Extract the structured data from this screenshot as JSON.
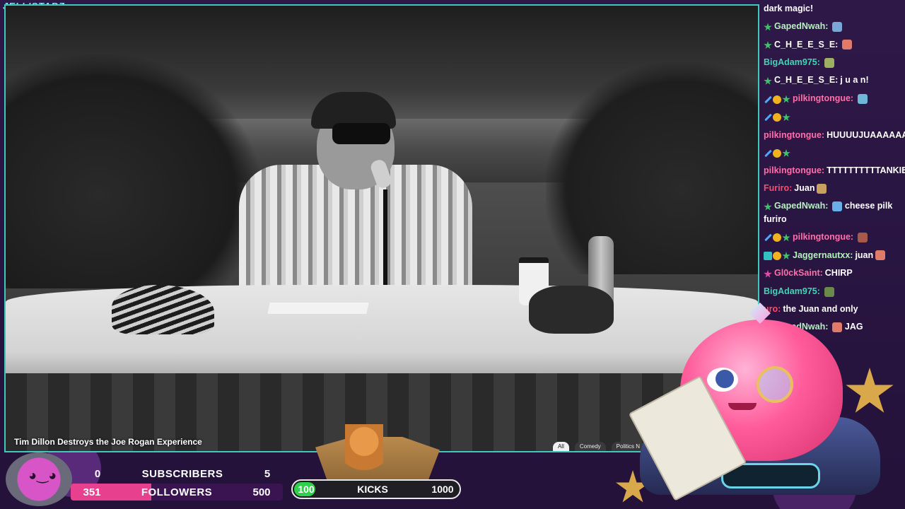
{
  "brand": "JELLISTARZ",
  "video": {
    "title": "Tim Dillon Destroys the Joe Rogan Experience",
    "chips": [
      "All",
      "Comedy",
      "Politics N"
    ]
  },
  "chat": [
    {
      "name": "",
      "name_color": "#ffffff",
      "badges": [],
      "text": "dark magic!"
    },
    {
      "name": "GapedNwah:",
      "name_color": "#b7f0c0",
      "badges": [
        "star"
      ],
      "text": "",
      "emote": "#7aa7d8"
    },
    {
      "name": "C_H_E_E_S_E:",
      "name_color": "#ffffff",
      "badges": [
        "star"
      ],
      "text": "",
      "emote": "#e07a6a"
    },
    {
      "name": "BigAdam975:",
      "name_color": "#3ed6b4",
      "badges": [],
      "text": "",
      "emote": "#9bb060"
    },
    {
      "name": "C_H_E_E_S_E:",
      "name_color": "#ffffff",
      "badges": [
        "star"
      ],
      "text": "j u a n!"
    },
    {
      "name": "pilkingtongue:",
      "name_color": "#ff6fa8",
      "badges": [
        "sword",
        "coin",
        "star"
      ],
      "text": "",
      "emote": "#6fb6d8"
    },
    {
      "name": "",
      "name_color": "#ffffff",
      "badges": [
        "sword",
        "coin",
        "star"
      ],
      "text": ""
    },
    {
      "name": "pilkingtongue:",
      "name_color": "#ff6fa8",
      "badges": [],
      "text": "HUUUUJUAAAAAAAAN"
    },
    {
      "name": "",
      "name_color": "#ffffff",
      "badges": [
        "sword",
        "coin",
        "star"
      ],
      "text": ""
    },
    {
      "name": "pilkingtongue:",
      "name_color": "#ff6fa8",
      "badges": [],
      "text": "TTTTTTTTTTANKIES"
    },
    {
      "name": "Furiro:",
      "name_color": "#ff4a6a",
      "badges": [],
      "text": "Juan",
      "emote": "#c8a060"
    },
    {
      "name": "GapedNwah:",
      "name_color": "#b7f0c0",
      "badges": [
        "star"
      ],
      "text": "cheese pilk furiro",
      "emote_before": "#6ab0e8"
    },
    {
      "name": "pilkingtongue:",
      "name_color": "#ff6fa8",
      "badges": [
        "sword",
        "coin",
        "star"
      ],
      "text": "",
      "emote": "#a85a4a"
    },
    {
      "name": "Jaggernautxx:",
      "name_color": "#b7f0c0",
      "badges": [
        "square",
        "coin",
        "star"
      ],
      "text": "juan",
      "emote": "#e07a6a"
    },
    {
      "name": "Gl0ckSaint:",
      "name_color": "#ff6fa8",
      "badges": [
        "pink"
      ],
      "text": "CHIRP"
    },
    {
      "name": "BigAdam975:",
      "name_color": "#3ed6b4",
      "badges": [],
      "text": "",
      "emote": "#6a8a4a"
    },
    {
      "name": "uro:",
      "name_color": "#ff4a6a",
      "badges": [],
      "text": "the Juan and only"
    },
    {
      "name": "GapedNwah:",
      "name_color": "#b7f0c0",
      "badges": [
        "star"
      ],
      "text": "JAG",
      "emote_before": "#e07a6a"
    }
  ],
  "stats": {
    "subscribers": {
      "label": "SUBSCRIBERS",
      "current": "0",
      "goal": "5"
    },
    "followers": {
      "label": "FOLLOWERS",
      "current": "351",
      "goal": "500",
      "progress": 0.38
    },
    "kicks": {
      "label": "KICKS",
      "current": "100",
      "goal": "1000",
      "progress": 0.1
    }
  },
  "colors": {
    "accent": "#3fc9b8",
    "followers_bar": "#e6408f",
    "kicks_bar": "#2fd04a"
  }
}
